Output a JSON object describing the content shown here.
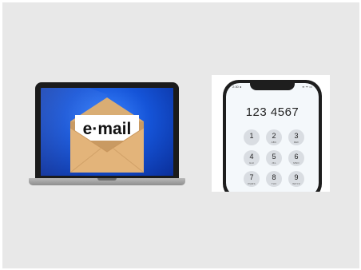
{
  "laptop": {
    "envelope_text": "e·mail"
  },
  "phone": {
    "status_time": "2:30 ◂",
    "status_icons": "▪▪ ᯤ ▭",
    "dial_number": "123 4567",
    "keys": [
      {
        "digit": "1",
        "letters": ""
      },
      {
        "digit": "2",
        "letters": "ABC"
      },
      {
        "digit": "3",
        "letters": "DEF"
      },
      {
        "digit": "4",
        "letters": "GHI"
      },
      {
        "digit": "5",
        "letters": "JKL"
      },
      {
        "digit": "6",
        "letters": "MNO"
      },
      {
        "digit": "7",
        "letters": "PQRS"
      },
      {
        "digit": "8",
        "letters": "TUV"
      },
      {
        "digit": "9",
        "letters": "WXYZ"
      }
    ]
  }
}
